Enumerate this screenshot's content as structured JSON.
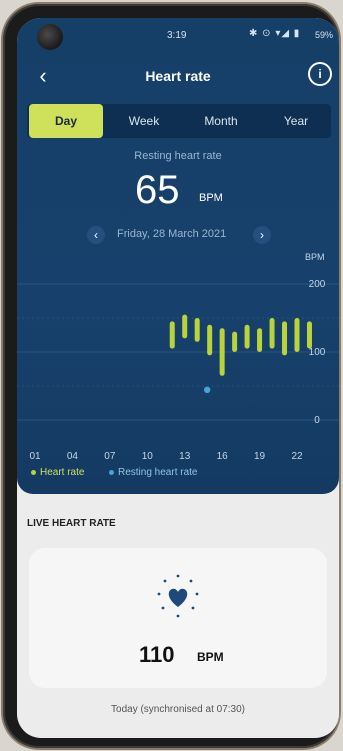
{
  "status_bar": {
    "time": "3:19",
    "icons": "✱ ⊙ ▾◢ ▮",
    "battery": "59%"
  },
  "header": {
    "title": "Heart rate",
    "back_icon": "back-chevron-icon",
    "info_icon": "info-icon"
  },
  "tabs": [
    {
      "label": "Day",
      "active": true
    },
    {
      "label": "Week",
      "active": false
    },
    {
      "label": "Month",
      "active": false
    },
    {
      "label": "Year",
      "active": false
    }
  ],
  "resting": {
    "label": "Resting heart rate",
    "value": "65",
    "unit": "BPM"
  },
  "date_nav": {
    "date": "Friday, 28 March 2021"
  },
  "chart_data": {
    "type": "bar",
    "ylabel": "BPM",
    "ylim": [
      0,
      200
    ],
    "y_ticks": [
      "200",
      "100",
      "0"
    ],
    "x_ticks": [
      "01",
      "04",
      "07",
      "10",
      "13",
      "16",
      "19",
      "22"
    ],
    "hours": [
      12,
      13,
      14,
      15,
      16,
      17,
      18,
      19,
      20,
      21,
      22,
      23
    ],
    "series": [
      {
        "name": "Heart rate",
        "color": "#b8d43a",
        "ranges": [
          [
            105,
            145
          ],
          [
            120,
            155
          ],
          [
            115,
            150
          ],
          [
            95,
            140
          ],
          [
            65,
            135
          ],
          [
            100,
            130
          ],
          [
            105,
            140
          ],
          [
            100,
            135
          ],
          [
            105,
            150
          ],
          [
            95,
            145
          ],
          [
            100,
            150
          ],
          [
            105,
            145
          ]
        ]
      },
      {
        "name": "Resting heart rate",
        "color": "#4aa3d6",
        "points": [
          {
            "hour": 14.8,
            "value": 65
          }
        ]
      }
    ],
    "legend": [
      "Heart rate",
      "Resting heart rate"
    ]
  },
  "live": {
    "section_title": "LIVE HEART RATE",
    "value": "110",
    "unit": "BPM",
    "icon": "heart-pulse-icon"
  },
  "sync_text": "Today (synchronised at 07:30)"
}
